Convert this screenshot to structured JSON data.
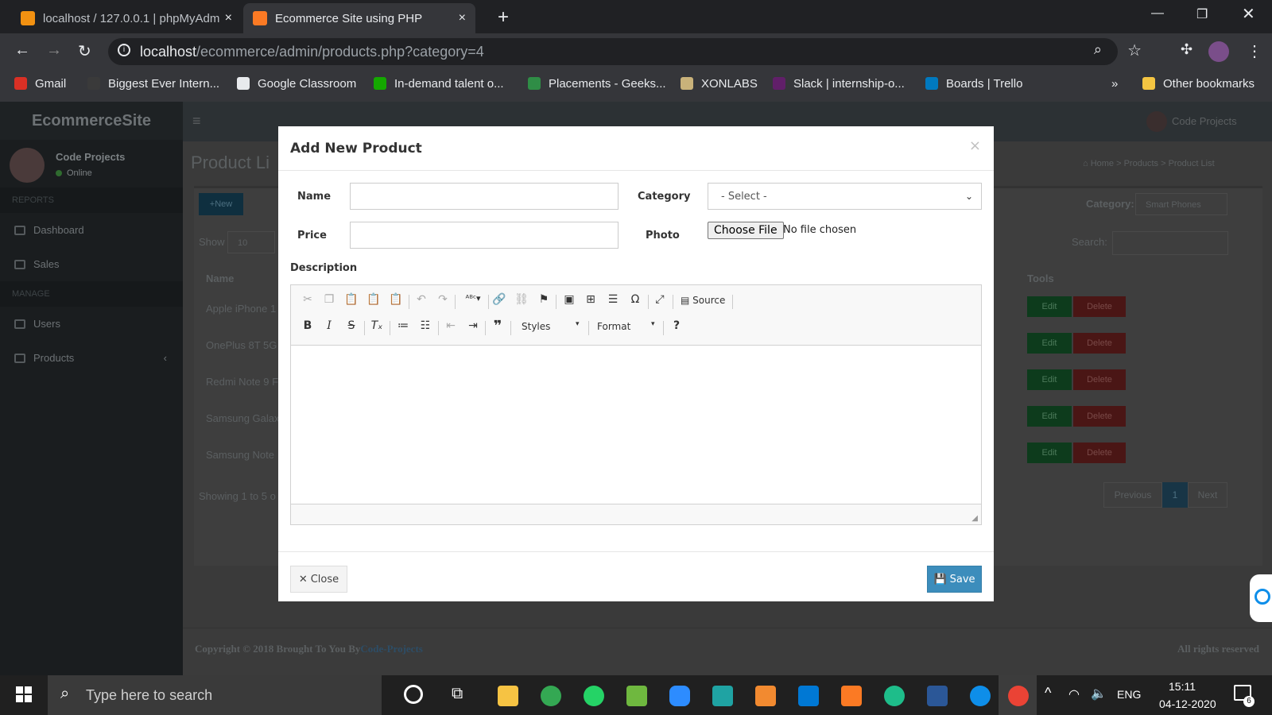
{
  "browser": {
    "tabs": [
      {
        "title": "localhost / 127.0.0.1 | phpMyAdm",
        "close": "×"
      },
      {
        "title": "Ecommerce Site using PHP",
        "close": "×"
      }
    ],
    "new_tab": "+",
    "address": {
      "host": "localhost",
      "path": "/ecommerce/admin/products.php?category=4"
    },
    "bookmarks": [
      "Gmail",
      "Biggest Ever Intern...",
      "Google Classroom",
      "In-demand talent o...",
      "Placements - Geeks...",
      "XONLABS",
      "Slack | internship-o...",
      "Boards | Trello"
    ],
    "overflow": "»",
    "other_bookmarks": "Other bookmarks"
  },
  "admin": {
    "brand": "EcommerceSite",
    "user_name": "Code Projects",
    "user_status": "Online",
    "sections": {
      "reports": "REPORTS",
      "manage": "MANAGE"
    },
    "menu": [
      "Dashboard",
      "Sales",
      "Users",
      "Products"
    ],
    "products_chevron": "‹",
    "hamburger": "≡",
    "top_user": "Code Projects",
    "page_title": "Product Li",
    "breadcrumb": [
      "Home",
      "Products",
      "Product List"
    ],
    "new_button": "+New",
    "category_label": "Category:",
    "category_value": "Smart Phones",
    "show_label": "Show",
    "show_value": "10",
    "search_label": "Search:",
    "columns": {
      "name": "Name",
      "tools": "Tools"
    },
    "rows": [
      "Apple iPhone 1",
      "OnePlus 8T 5G",
      "Redmi Note 9 F",
      "Samsung Galax",
      "Samsung Note"
    ],
    "edit_label": "Edit",
    "delete_label": "Delete",
    "showing": "Showing 1 to 5 o",
    "pagination": {
      "previous": "Previous",
      "page": "1",
      "next": "Next"
    },
    "footer_left": "Copyright © 2018 Brought To You By",
    "footer_link": "Code-Projects",
    "footer_right": "All rights reserved"
  },
  "modal": {
    "title": "Add New Product",
    "close_x": "×",
    "name_label": "Name",
    "price_label": "Price",
    "category_label": "Category",
    "category_value": "- Select -",
    "photo_label": "Photo",
    "choose_file": "Choose File",
    "no_file": "No file chosen",
    "description_label": "Description",
    "editor": {
      "source": "Source",
      "styles": "Styles",
      "format": "Format",
      "help": "?"
    },
    "close_button": "Close",
    "save_button": "Save"
  },
  "taskbar": {
    "search_placeholder": "Type here to search",
    "lang": "ENG",
    "time": "15:11",
    "date": "04-12-2020",
    "notifications": "6"
  },
  "colors": {
    "accent": "#3c8dbc",
    "overlay": "#3b3b3b",
    "edit": "#00a65a",
    "delete": "#dd4b39"
  }
}
